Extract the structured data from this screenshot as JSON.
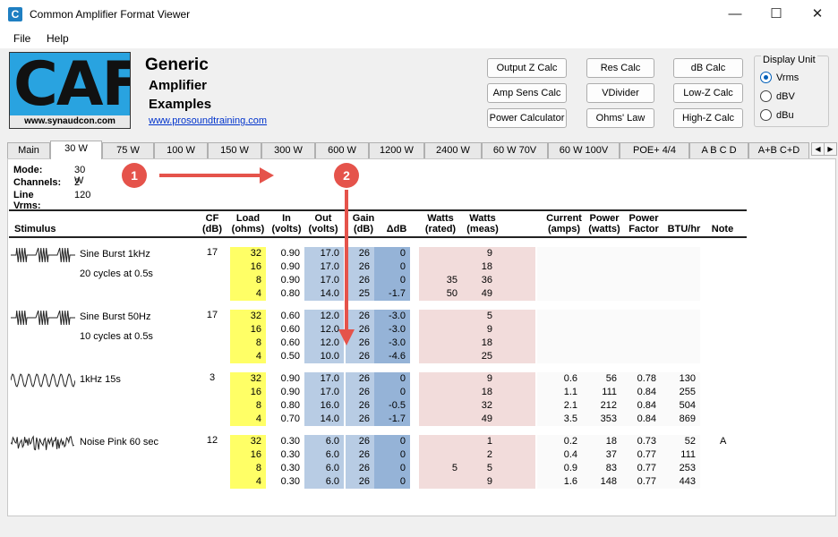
{
  "window": {
    "title": "Common Amplifier Format Viewer",
    "icon_letter": "C"
  },
  "menu": [
    "File",
    "Help"
  ],
  "header": {
    "logo_text": "CAF",
    "logo_url": "www.synaudcon.com",
    "title": "Generic",
    "subtitle1": "Amplifier",
    "subtitle2": "Examples",
    "link": "www.prosoundtraining.com"
  },
  "buttons": {
    "output_z": "Output Z Calc",
    "res": "Res Calc",
    "db": "dB Calc",
    "amp_sens": "Amp Sens Calc",
    "vdivider": "VDivider",
    "low_z": "Low-Z Calc",
    "power": "Power Calculator",
    "ohms": "Ohms' Law",
    "high_z": "High-Z Calc"
  },
  "display_unit": {
    "legend": "Display Unit",
    "options": [
      "Vrms",
      "dBV",
      "dBu"
    ],
    "selected": "Vrms"
  },
  "tabs": [
    "Main",
    "30 W",
    "75 W",
    "100 W",
    "150 W",
    "300 W",
    "600 W",
    "1200 W",
    "2400 W",
    "60 W 70V",
    "60 W 100V",
    "POE+ 4/4",
    "A B C D",
    "A+B C+D"
  ],
  "active_tab": "30 W",
  "info": {
    "mode_k": "Mode:",
    "mode_v": "30 W",
    "channels_k": "Channels:",
    "channels_v": "2",
    "line_k": "Line Vrms:",
    "line_v": "120"
  },
  "columns": {
    "stimulus": "Stimulus",
    "cf1": "CF",
    "cf2": "(dB)",
    "load1": "Load",
    "load2": "(ohms)",
    "in1": "In",
    "in2": "(volts)",
    "out1": "Out",
    "out2": "(volts)",
    "gain1": "Gain",
    "gain2": "(dB)",
    "ddb": "ΔdB",
    "wr1": "Watts",
    "wr2": "(rated)",
    "wm1": "Watts",
    "wm2": "(meas)",
    "cur1": "Current",
    "cur2": "(amps)",
    "pw1": "Power",
    "pw2": "(watts)",
    "pf1": "Power",
    "pf2": "Factor",
    "btu": "BTU/hr",
    "note": "Note"
  },
  "groups": [
    {
      "name": "Sine Burst 1kHz",
      "detail": "20 cycles at 0.5s",
      "cf": "17",
      "wave": "burst",
      "rows": [
        {
          "load": "32",
          "in": "0.90",
          "out": "17.0",
          "gain": "26",
          "ddb": "0",
          "wr": "",
          "wm": "9",
          "cur": "",
          "pw": "",
          "pf": "",
          "btu": "",
          "note": ""
        },
        {
          "load": "16",
          "in": "0.90",
          "out": "17.0",
          "gain": "26",
          "ddb": "0",
          "wr": "",
          "wm": "18",
          "cur": "",
          "pw": "",
          "pf": "",
          "btu": "",
          "note": ""
        },
        {
          "load": "8",
          "in": "0.90",
          "out": "17.0",
          "gain": "26",
          "ddb": "0",
          "wr": "35",
          "wm": "36",
          "cur": "",
          "pw": "",
          "pf": "",
          "btu": "",
          "note": ""
        },
        {
          "load": "4",
          "in": "0.80",
          "out": "14.0",
          "gain": "25",
          "ddb": "-1.7",
          "wr": "50",
          "wm": "49",
          "cur": "",
          "pw": "",
          "pf": "",
          "btu": "",
          "note": ""
        }
      ]
    },
    {
      "name": "Sine Burst 50Hz",
      "detail": "10 cycles at 0.5s",
      "cf": "17",
      "wave": "burst",
      "rows": [
        {
          "load": "32",
          "in": "0.60",
          "out": "12.0",
          "gain": "26",
          "ddb": "-3.0",
          "wr": "",
          "wm": "5",
          "cur": "",
          "pw": "",
          "pf": "",
          "btu": "",
          "note": ""
        },
        {
          "load": "16",
          "in": "0.60",
          "out": "12.0",
          "gain": "26",
          "ddb": "-3.0",
          "wr": "",
          "wm": "9",
          "cur": "",
          "pw": "",
          "pf": "",
          "btu": "",
          "note": ""
        },
        {
          "load": "8",
          "in": "0.60",
          "out": "12.0",
          "gain": "26",
          "ddb": "-3.0",
          "wr": "",
          "wm": "18",
          "cur": "",
          "pw": "",
          "pf": "",
          "btu": "",
          "note": ""
        },
        {
          "load": "4",
          "in": "0.50",
          "out": "10.0",
          "gain": "26",
          "ddb": "-4.6",
          "wr": "",
          "wm": "25",
          "cur": "",
          "pw": "",
          "pf": "",
          "btu": "",
          "note": ""
        }
      ]
    },
    {
      "name": "1kHz 15s",
      "detail": "",
      "cf": "3",
      "wave": "sine",
      "rows": [
        {
          "load": "32",
          "in": "0.90",
          "out": "17.0",
          "gain": "26",
          "ddb": "0",
          "wr": "",
          "wm": "9",
          "cur": "0.6",
          "pw": "56",
          "pf": "0.78",
          "btu": "130",
          "note": ""
        },
        {
          "load": "16",
          "in": "0.90",
          "out": "17.0",
          "gain": "26",
          "ddb": "0",
          "wr": "",
          "wm": "18",
          "cur": "1.1",
          "pw": "111",
          "pf": "0.84",
          "btu": "255",
          "note": ""
        },
        {
          "load": "8",
          "in": "0.80",
          "out": "16.0",
          "gain": "26",
          "ddb": "-0.5",
          "wr": "",
          "wm": "32",
          "cur": "2.1",
          "pw": "212",
          "pf": "0.84",
          "btu": "504",
          "note": ""
        },
        {
          "load": "4",
          "in": "0.70",
          "out": "14.0",
          "gain": "26",
          "ddb": "-1.7",
          "wr": "",
          "wm": "49",
          "cur": "3.5",
          "pw": "353",
          "pf": "0.84",
          "btu": "869",
          "note": ""
        }
      ]
    },
    {
      "name": "Noise Pink 60 sec",
      "detail": "",
      "cf": "12",
      "wave": "noise",
      "rows": [
        {
          "load": "32",
          "in": "0.30",
          "out": "6.0",
          "gain": "26",
          "ddb": "0",
          "wr": "",
          "wm": "1",
          "cur": "0.2",
          "pw": "18",
          "pf": "0.73",
          "btu": "52",
          "note": "A"
        },
        {
          "load": "16",
          "in": "0.30",
          "out": "6.0",
          "gain": "26",
          "ddb": "0",
          "wr": "",
          "wm": "2",
          "cur": "0.4",
          "pw": "37",
          "pf": "0.77",
          "btu": "111",
          "note": ""
        },
        {
          "load": "8",
          "in": "0.30",
          "out": "6.0",
          "gain": "26",
          "ddb": "0",
          "wr": "5",
          "wm": "5",
          "cur": "0.9",
          "pw": "83",
          "pf": "0.77",
          "btu": "253",
          "note": ""
        },
        {
          "load": "4",
          "in": "0.30",
          "out": "6.0",
          "gain": "26",
          "ddb": "0",
          "wr": "",
          "wm": "9",
          "cur": "1.6",
          "pw": "148",
          "pf": "0.77",
          "btu": "443",
          "note": ""
        }
      ]
    }
  ],
  "annotations": {
    "badge1": "1",
    "badge2": "2",
    "color": "#e5534b"
  }
}
